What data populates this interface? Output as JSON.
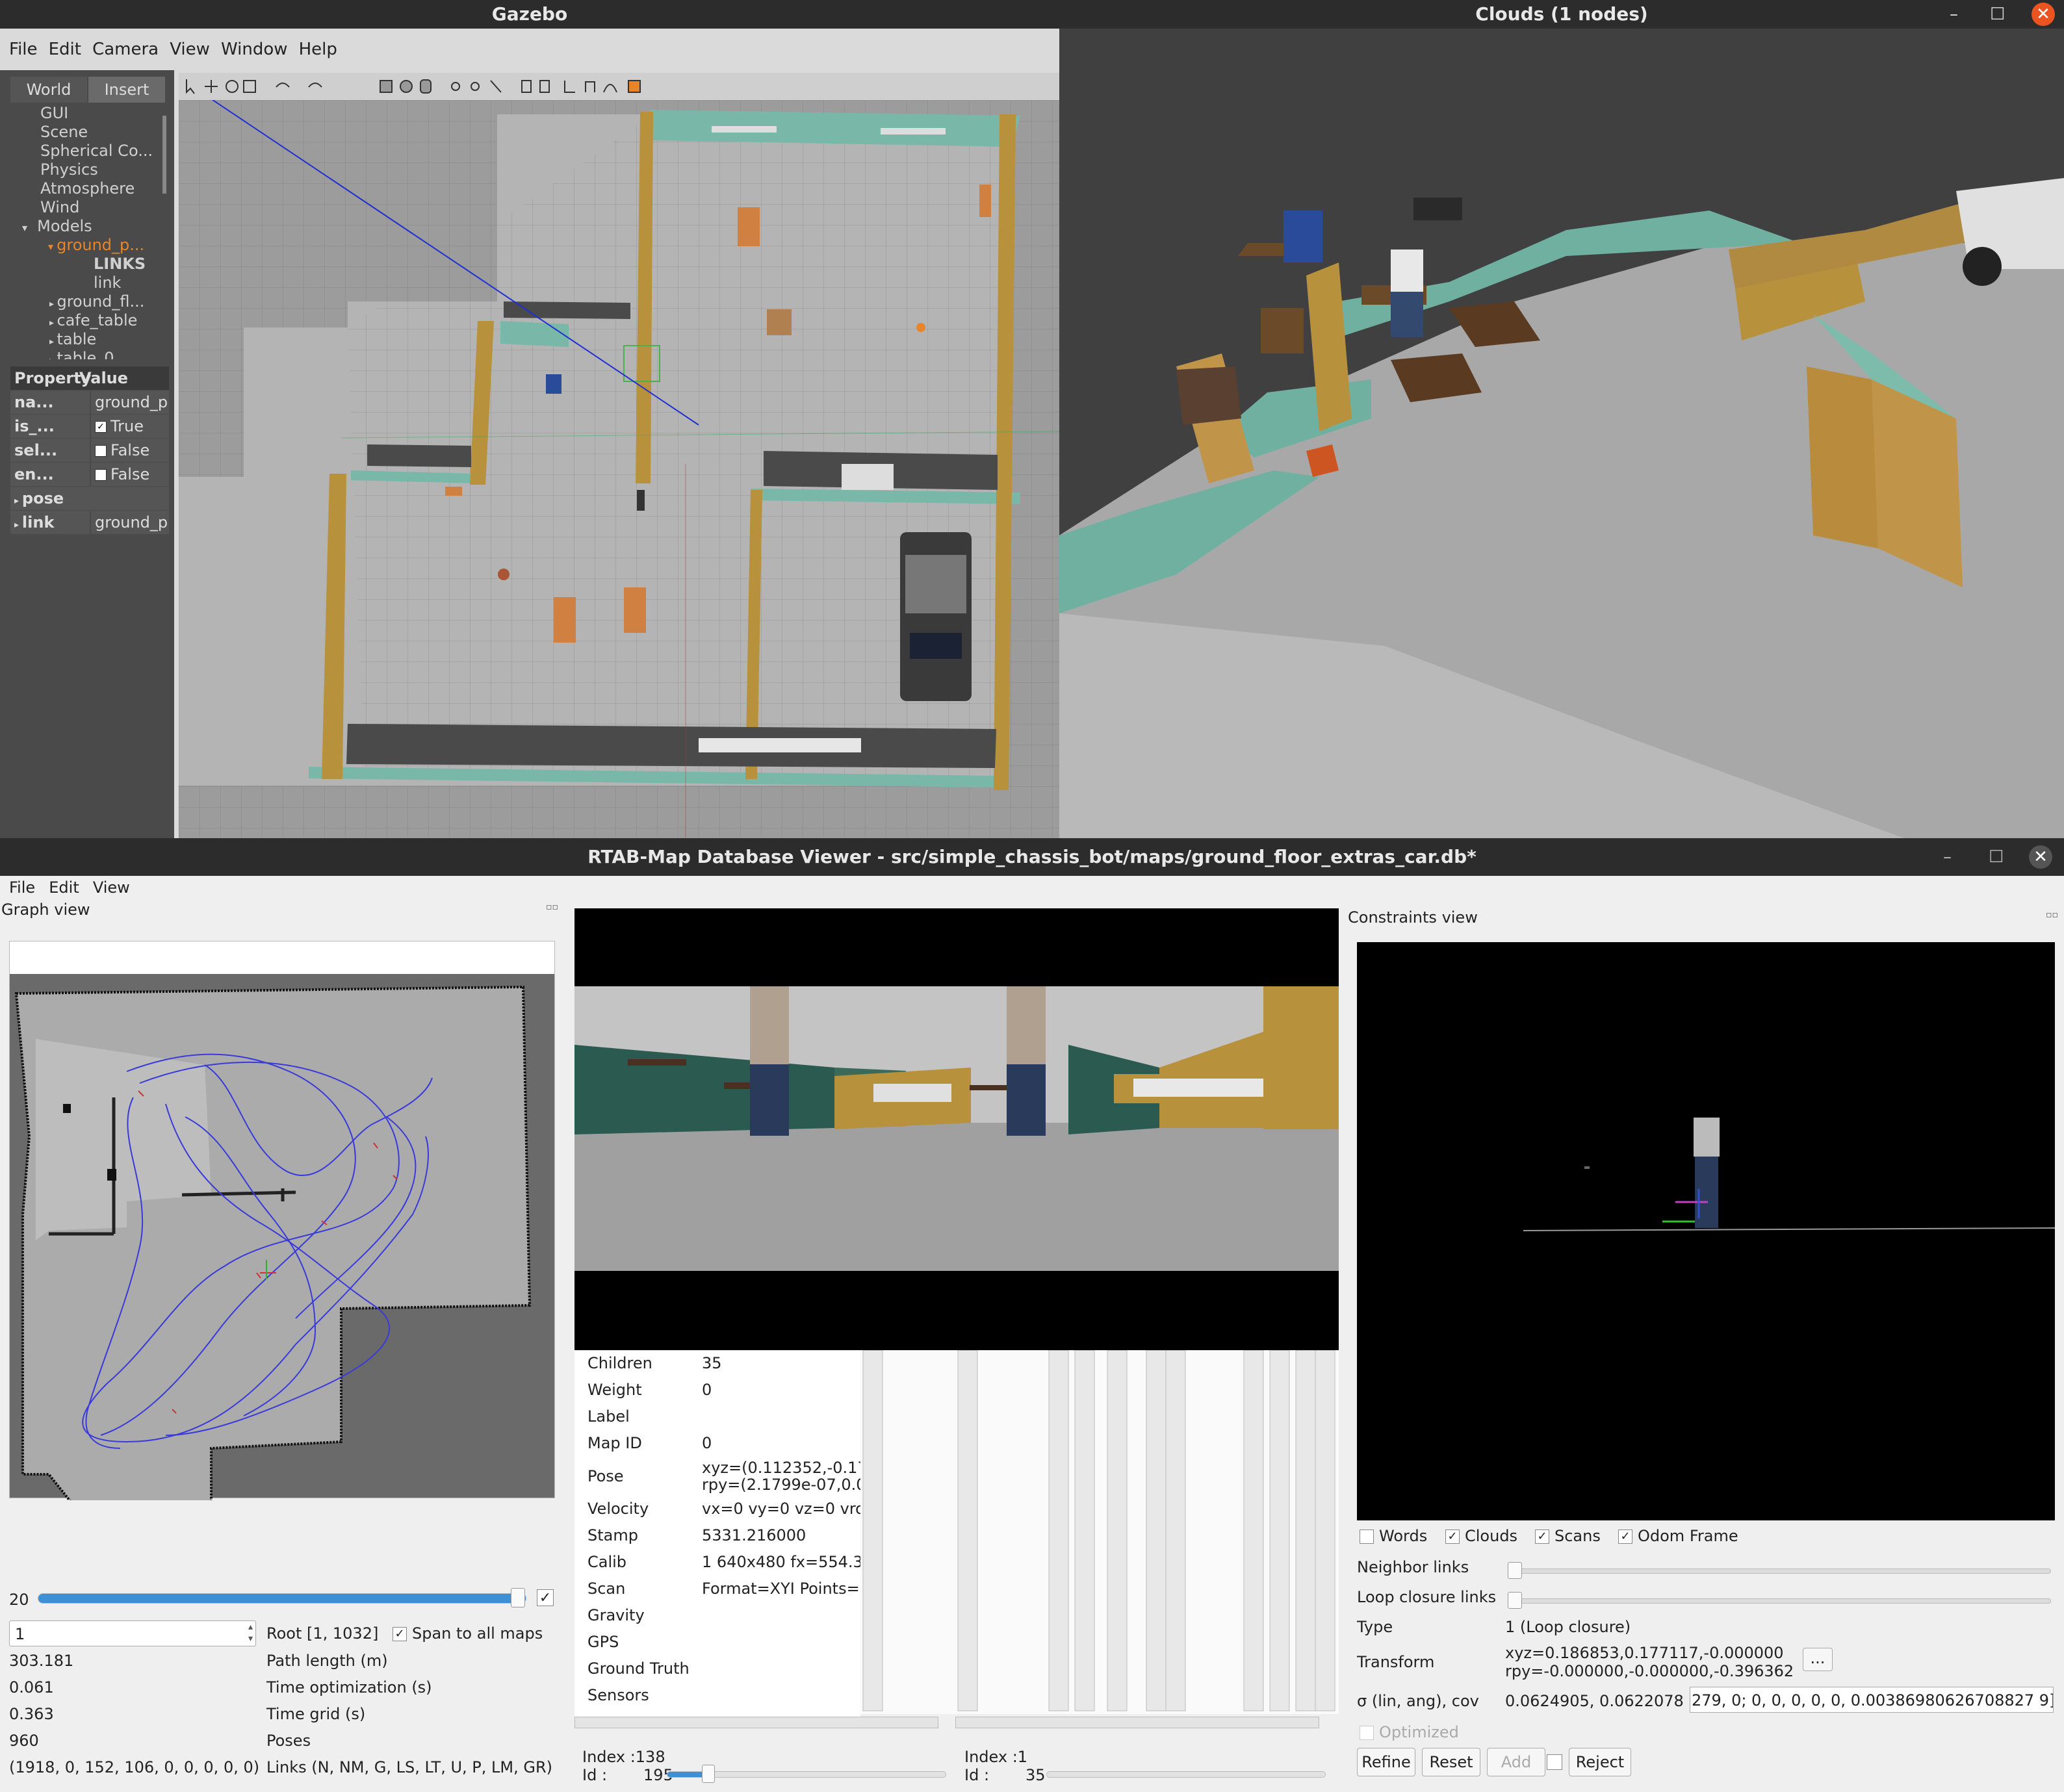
{
  "gazebo": {
    "title": "Gazebo",
    "menu": [
      "File",
      "Edit",
      "Camera",
      "View",
      "Window",
      "Help"
    ],
    "tabs": [
      "World",
      "Insert"
    ],
    "tree": [
      "GUI",
      "Scene",
      "Spherical Co...",
      "Physics",
      "Atmosphere",
      "Wind",
      "Models",
      "ground_p...",
      "LINKS",
      "link",
      "ground_fl...",
      "cafe_table",
      "table",
      "table_0"
    ],
    "property_header": {
      "property": "Property",
      "value": "Value"
    },
    "properties": [
      {
        "key": "na...",
        "value": "ground_p"
      },
      {
        "key": "is_...",
        "value": "True",
        "checked": "✓"
      },
      {
        "key": "sel...",
        "value": "False",
        "checked": ""
      },
      {
        "key": "en...",
        "value": "False",
        "checked": ""
      },
      {
        "key": "pose",
        "value": ""
      },
      {
        "key": "link",
        "value": "ground_p"
      }
    ]
  },
  "clouds": {
    "title": "Clouds (1 nodes)",
    "buttons": {
      "minimize": "–",
      "maximize": "☐",
      "close": "✕"
    }
  },
  "rtab": {
    "title": "RTAB-Map Database Viewer - src/simple_chassis_bot/maps/ground_floor_extras_car.db*",
    "menu": [
      "File",
      "Edit",
      "View"
    ],
    "graph_view_label": "Graph view",
    "graph_slider_value": "20",
    "root_spin_value": "1",
    "root_label": "Root [1, 1032]",
    "span_label": "Span to all maps",
    "stats": [
      {
        "value": "303.181",
        "label": "Path length (m)"
      },
      {
        "value": "0.061",
        "label": "Time optimization (s)"
      },
      {
        "value": "0.363",
        "label": "Time grid (s)"
      },
      {
        "value": "960",
        "label": "Poses"
      },
      {
        "value": "(1918, 0, 152, 106, 0, 0, 0, 0, 0)",
        "label": "Links (N, NM, G, LS, LT, U, P, LM, GR)"
      }
    ],
    "info": [
      {
        "key": "Children",
        "value": "35"
      },
      {
        "key": "Weight",
        "value": "0"
      },
      {
        "key": "Label",
        "value": ""
      },
      {
        "key": "Map ID",
        "value": "0"
      },
      {
        "key": "Pose",
        "value": "xyz=(0.112352,-0.17",
        "value2": "rpy=(2.1799e-07,0.0"
      },
      {
        "key": "Velocity",
        "value": "vx=0 vy=0 vz=0 vro"
      },
      {
        "key": "Stamp",
        "value": "5331.216000"
      },
      {
        "key": "Calib",
        "value": "1 640x480 fx=554.3"
      },
      {
        "key": "Scan",
        "value": "Format=XYI Points="
      },
      {
        "key": "Gravity",
        "value": ""
      },
      {
        "key": "GPS",
        "value": ""
      },
      {
        "key": "Ground Truth",
        "value": ""
      },
      {
        "key": "Sensors",
        "value": ""
      }
    ],
    "index_a": {
      "index": "Index :138",
      "id_label": "Id :",
      "id": "195"
    },
    "index_b": {
      "index": "Index :1",
      "id_label": "Id :",
      "id": "35"
    },
    "constraints_label": "Constraints view",
    "checks": [
      {
        "label": "Words",
        "checked": ""
      },
      {
        "label": "Clouds",
        "checked": "✓"
      },
      {
        "label": "Scans",
        "checked": "✓"
      },
      {
        "label": "Odom Frame",
        "checked": "✓"
      }
    ],
    "neighbor_links": "Neighbor links",
    "loop_closure_links": "Loop closure links",
    "type_label": "Type",
    "type_value": "1  (Loop closure)",
    "transform_label": "Transform",
    "transform_xyz": "xyz=0.186853,0.177117,-0.000000",
    "transform_rpy": "rpy=-0.000000,-0.000000,-0.396362",
    "transform_btn": "...",
    "sigma_label": "σ (lin, ang), cov",
    "sigma_value": "0.0624905, 0.0622078",
    "cov_value": "279, 0;  0, 0, 0, 0, 0, 0.00386980626708827 9]",
    "optimized_label": "Optimized",
    "buttons": {
      "refine": "Refine",
      "reset": "Reset",
      "add": "Add",
      "reject": "Reject"
    },
    "colors": {
      "path": "#3a3ad8",
      "accent": "#3d8fd6",
      "wall_teal": "#79b8a8",
      "wall_brown": "#b8913d"
    }
  }
}
